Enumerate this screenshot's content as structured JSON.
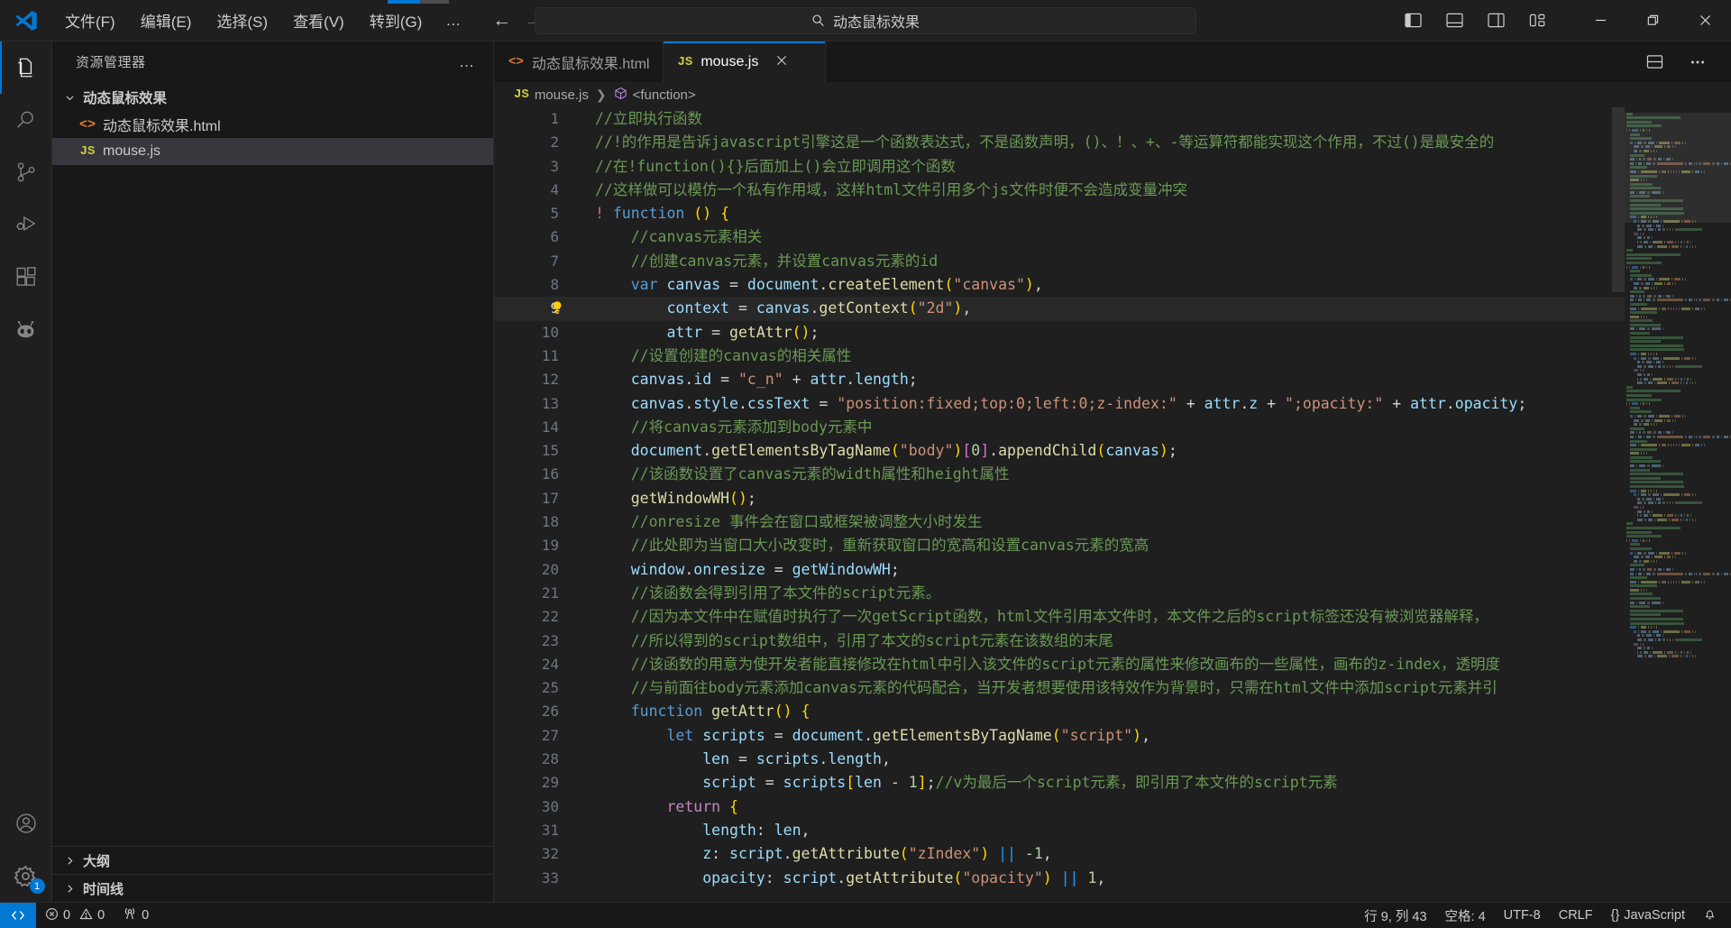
{
  "titlebar": {
    "logo_name": "vscode-logo",
    "menus": [
      "文件(F)",
      "编辑(E)",
      "选择(S)",
      "查看(V)",
      "转到(G)"
    ],
    "more_label": "…",
    "back_label": "←",
    "forward_label": "→",
    "command_center_text": "动态鼠标效果",
    "search_icon": "search-icon",
    "layout_buttons": [
      "toggle-primary-sidebar",
      "toggle-panel",
      "toggle-secondary-sidebar",
      "customize-layout"
    ],
    "window_controls": {
      "minimize": "—",
      "restore": "❐",
      "close": "✕"
    },
    "progress_percent": 52
  },
  "activitybar": {
    "items": [
      {
        "name": "explorer",
        "icon": "files-icon",
        "active": true
      },
      {
        "name": "search",
        "icon": "search-icon",
        "active": false
      },
      {
        "name": "source-control",
        "icon": "source-control-icon",
        "active": false
      },
      {
        "name": "run-and-debug",
        "icon": "debug-icon",
        "active": false
      },
      {
        "name": "extensions",
        "icon": "extensions-icon",
        "active": false
      },
      {
        "name": "copilot",
        "icon": "robot-icon",
        "active": false
      }
    ],
    "bottom": [
      {
        "name": "accounts",
        "icon": "account-icon",
        "badge": ""
      },
      {
        "name": "manage",
        "icon": "gear-icon",
        "badge": "1"
      }
    ]
  },
  "sidebar": {
    "title": "资源管理器",
    "more_actions": "…",
    "tree": [
      {
        "label": "动态鼠标效果",
        "type": "folder",
        "expanded": true,
        "selected": false
      },
      {
        "label": "动态鼠标效果.html",
        "type": "html",
        "selected": false
      },
      {
        "label": "mouse.js",
        "type": "js",
        "selected": true
      }
    ],
    "sections": [
      {
        "label": "大纲",
        "expanded": false
      },
      {
        "label": "时间线",
        "expanded": false
      }
    ]
  },
  "editor": {
    "tabs": [
      {
        "label": "动态鼠标效果.html",
        "type": "html",
        "active": false,
        "closable": false
      },
      {
        "label": "mouse.js",
        "type": "js",
        "active": true,
        "closable": true
      }
    ],
    "tab_actions": [
      "split-editor",
      "more-actions"
    ],
    "breadcrumb": [
      {
        "label": "mouse.js",
        "icon": "js-icon"
      },
      {
        "label": "<function>",
        "icon": "symbol-module-icon"
      }
    ],
    "current_line": 9,
    "first_line": 1,
    "lines": [
      {
        "n": 1,
        "tokens": [
          {
            "t": "//立即执行函数",
            "k": "c"
          }
        ]
      },
      {
        "n": 2,
        "tokens": [
          {
            "t": "//!的作用是告诉javascript引擎这是一个函数表达式，不是函数声明，()、！、+、-等运算符都能实现这个作用，不过()是最安全的",
            "k": "c"
          }
        ]
      },
      {
        "n": 3,
        "tokens": [
          {
            "t": "//在!function(){}后面加上()会立即调用这个函数",
            "k": "c"
          }
        ]
      },
      {
        "n": 4,
        "tokens": [
          {
            "t": "//这样做可以模仿一个私有作用域，这样html文件引用多个js文件时便不会造成变量冲突",
            "k": "c"
          }
        ]
      },
      {
        "n": 5,
        "tokens": [
          {
            "t": "!",
            "k": "bang"
          },
          {
            "t": " ",
            "k": "op"
          },
          {
            "t": "function",
            "k": "kw"
          },
          {
            "t": " ",
            "k": "op"
          },
          {
            "t": "()",
            "k": "p1"
          },
          {
            "t": " ",
            "k": "op"
          },
          {
            "t": "{",
            "k": "p1"
          }
        ]
      },
      {
        "n": 6,
        "indent": 1,
        "tokens": [
          {
            "t": "//canvas元素相关",
            "k": "c"
          }
        ]
      },
      {
        "n": 7,
        "indent": 1,
        "tokens": [
          {
            "t": "//创建canvas元素，并设置canvas元素的id",
            "k": "c"
          }
        ]
      },
      {
        "n": 8,
        "indent": 1,
        "tokens": [
          {
            "t": "var",
            "k": "kw"
          },
          {
            "t": " ",
            "k": "op"
          },
          {
            "t": "canvas",
            "k": "vn"
          },
          {
            "t": " = ",
            "k": "op"
          },
          {
            "t": "document",
            "k": "vn"
          },
          {
            "t": ".",
            "k": "op"
          },
          {
            "t": "createElement",
            "k": "fn"
          },
          {
            "t": "(",
            "k": "p1"
          },
          {
            "t": "\"canvas\"",
            "k": "st"
          },
          {
            "t": ")",
            "k": "p1"
          },
          {
            "t": ",",
            "k": "op"
          }
        ]
      },
      {
        "n": 9,
        "indent": 2,
        "bulb": true,
        "tokens": [
          {
            "t": "context",
            "k": "vn"
          },
          {
            "t": " = ",
            "k": "op"
          },
          {
            "t": "canvas",
            "k": "vn"
          },
          {
            "t": ".",
            "k": "op"
          },
          {
            "t": "getContext",
            "k": "fn"
          },
          {
            "t": "(",
            "k": "p1"
          },
          {
            "t": "\"2d\"",
            "k": "st"
          },
          {
            "t": ")",
            "k": "p1"
          },
          {
            "t": ",",
            "k": "op"
          }
        ]
      },
      {
        "n": 10,
        "indent": 2,
        "tokens": [
          {
            "t": "attr",
            "k": "vn"
          },
          {
            "t": " = ",
            "k": "op"
          },
          {
            "t": "getAttr",
            "k": "fn"
          },
          {
            "t": "(",
            "k": "p1"
          },
          {
            "t": ")",
            "k": "p1"
          },
          {
            "t": ";",
            "k": "op"
          }
        ]
      },
      {
        "n": 11,
        "indent": 1,
        "tokens": [
          {
            "t": "//设置创建的canvas的相关属性",
            "k": "c"
          }
        ]
      },
      {
        "n": 12,
        "indent": 1,
        "tokens": [
          {
            "t": "canvas",
            "k": "vn"
          },
          {
            "t": ".",
            "k": "op"
          },
          {
            "t": "id",
            "k": "vn"
          },
          {
            "t": " = ",
            "k": "op"
          },
          {
            "t": "\"c_n\"",
            "k": "st"
          },
          {
            "t": " + ",
            "k": "op"
          },
          {
            "t": "attr",
            "k": "vn"
          },
          {
            "t": ".",
            "k": "op"
          },
          {
            "t": "length",
            "k": "vn"
          },
          {
            "t": ";",
            "k": "op"
          }
        ]
      },
      {
        "n": 13,
        "indent": 1,
        "tokens": [
          {
            "t": "canvas",
            "k": "vn"
          },
          {
            "t": ".",
            "k": "op"
          },
          {
            "t": "style",
            "k": "vn"
          },
          {
            "t": ".",
            "k": "op"
          },
          {
            "t": "cssText",
            "k": "vn"
          },
          {
            "t": " = ",
            "k": "op"
          },
          {
            "t": "\"position:fixed;top:0;left:0;z-index:\"",
            "k": "st"
          },
          {
            "t": " + ",
            "k": "op"
          },
          {
            "t": "attr",
            "k": "vn"
          },
          {
            "t": ".",
            "k": "op"
          },
          {
            "t": "z",
            "k": "vn"
          },
          {
            "t": " + ",
            "k": "op"
          },
          {
            "t": "\";opacity:\"",
            "k": "st"
          },
          {
            "t": " + ",
            "k": "op"
          },
          {
            "t": "attr",
            "k": "vn"
          },
          {
            "t": ".",
            "k": "op"
          },
          {
            "t": "opacity",
            "k": "vn"
          },
          {
            "t": ";",
            "k": "op"
          }
        ]
      },
      {
        "n": 14,
        "indent": 1,
        "tokens": [
          {
            "t": "//将canvas元素添加到body元素中",
            "k": "c"
          }
        ]
      },
      {
        "n": 15,
        "indent": 1,
        "tokens": [
          {
            "t": "document",
            "k": "vn"
          },
          {
            "t": ".",
            "k": "op"
          },
          {
            "t": "getElementsByTagName",
            "k": "fn"
          },
          {
            "t": "(",
            "k": "p1"
          },
          {
            "t": "\"body\"",
            "k": "st"
          },
          {
            "t": ")",
            "k": "p1"
          },
          {
            "t": "[",
            "k": "p2"
          },
          {
            "t": "0",
            "k": "nm"
          },
          {
            "t": "]",
            "k": "p2"
          },
          {
            "t": ".",
            "k": "op"
          },
          {
            "t": "appendChild",
            "k": "fn"
          },
          {
            "t": "(",
            "k": "p1"
          },
          {
            "t": "canvas",
            "k": "vn"
          },
          {
            "t": ")",
            "k": "p1"
          },
          {
            "t": ";",
            "k": "op"
          }
        ]
      },
      {
        "n": 16,
        "indent": 1,
        "tokens": [
          {
            "t": "//该函数设置了canvas元素的width属性和height属性",
            "k": "c"
          }
        ]
      },
      {
        "n": 17,
        "indent": 1,
        "tokens": [
          {
            "t": "getWindowWH",
            "k": "fn"
          },
          {
            "t": "(",
            "k": "p1"
          },
          {
            "t": ")",
            "k": "p1"
          },
          {
            "t": ";",
            "k": "op"
          }
        ]
      },
      {
        "n": 18,
        "indent": 1,
        "tokens": [
          {
            "t": "//onresize 事件会在窗口或框架被调整大小时发生",
            "k": "c"
          }
        ]
      },
      {
        "n": 19,
        "indent": 1,
        "tokens": [
          {
            "t": "//此处即为当窗口大小改变时，重新获取窗口的宽高和设置canvas元素的宽高",
            "k": "c"
          }
        ]
      },
      {
        "n": 20,
        "indent": 1,
        "tokens": [
          {
            "t": "window",
            "k": "vn"
          },
          {
            "t": ".",
            "k": "op"
          },
          {
            "t": "onresize",
            "k": "vn"
          },
          {
            "t": " = ",
            "k": "op"
          },
          {
            "t": "getWindowWH",
            "k": "vn"
          },
          {
            "t": ";",
            "k": "op"
          }
        ]
      },
      {
        "n": 21,
        "indent": 1,
        "tokens": [
          {
            "t": "//该函数会得到引用了本文件的script元素。",
            "k": "c"
          }
        ]
      },
      {
        "n": 22,
        "indent": 1,
        "tokens": [
          {
            "t": "//因为本文件中在赋值时执行了一次getScript函数，html文件引用本文件时，本文件之后的script标签还没有被浏览器解释，",
            "k": "c"
          }
        ]
      },
      {
        "n": 23,
        "indent": 1,
        "tokens": [
          {
            "t": "//所以得到的script数组中，引用了本文的script元素在该数组的末尾",
            "k": "c"
          }
        ]
      },
      {
        "n": 24,
        "indent": 1,
        "tokens": [
          {
            "t": "//该函数的用意为使开发者能直接修改在html中引入该文件的script元素的属性来修改画布的一些属性，画布的z-index，透明度",
            "k": "c"
          }
        ]
      },
      {
        "n": 25,
        "indent": 1,
        "tokens": [
          {
            "t": "//与前面往body元素添加canvas元素的代码配合，当开发者想要使用该特效作为背景时，只需在html文件中添加script元素并引",
            "k": "c"
          }
        ]
      },
      {
        "n": 26,
        "indent": 1,
        "tokens": [
          {
            "t": "function",
            "k": "kw"
          },
          {
            "t": " ",
            "k": "op"
          },
          {
            "t": "getAttr",
            "k": "fn"
          },
          {
            "t": "(",
            "k": "p1"
          },
          {
            "t": ")",
            "k": "p1"
          },
          {
            "t": " ",
            "k": "op"
          },
          {
            "t": "{",
            "k": "p1"
          }
        ]
      },
      {
        "n": 27,
        "indent": 2,
        "tokens": [
          {
            "t": "let",
            "k": "kw"
          },
          {
            "t": " ",
            "k": "op"
          },
          {
            "t": "scripts",
            "k": "vn"
          },
          {
            "t": " = ",
            "k": "op"
          },
          {
            "t": "document",
            "k": "vn"
          },
          {
            "t": ".",
            "k": "op"
          },
          {
            "t": "getElementsByTagName",
            "k": "fn"
          },
          {
            "t": "(",
            "k": "p1"
          },
          {
            "t": "\"script\"",
            "k": "st"
          },
          {
            "t": ")",
            "k": "p1"
          },
          {
            "t": ",",
            "k": "op"
          }
        ]
      },
      {
        "n": 28,
        "indent": 3,
        "tokens": [
          {
            "t": "len",
            "k": "vn"
          },
          {
            "t": " = ",
            "k": "op"
          },
          {
            "t": "scripts",
            "k": "vn"
          },
          {
            "t": ".",
            "k": "op"
          },
          {
            "t": "length",
            "k": "vn"
          },
          {
            "t": ",",
            "k": "op"
          }
        ]
      },
      {
        "n": 29,
        "indent": 3,
        "tokens": [
          {
            "t": "script",
            "k": "vn"
          },
          {
            "t": " = ",
            "k": "op"
          },
          {
            "t": "scripts",
            "k": "vn"
          },
          {
            "t": "[",
            "k": "p1"
          },
          {
            "t": "len",
            "k": "vn"
          },
          {
            "t": " - ",
            "k": "op"
          },
          {
            "t": "1",
            "k": "nm"
          },
          {
            "t": "]",
            "k": "p1"
          },
          {
            "t": ";",
            "k": "op"
          },
          {
            "t": "//v为最后一个script元素，即引用了本文件的script元素",
            "k": "c"
          }
        ]
      },
      {
        "n": 30,
        "indent": 2,
        "tokens": [
          {
            "t": "return",
            "k": "kwp"
          },
          {
            "t": " ",
            "k": "op"
          },
          {
            "t": "{",
            "k": "p1"
          }
        ]
      },
      {
        "n": 31,
        "indent": 3,
        "tokens": [
          {
            "t": "length",
            "k": "vn"
          },
          {
            "t": ": ",
            "k": "op"
          },
          {
            "t": "len",
            "k": "vn"
          },
          {
            "t": ",",
            "k": "op"
          }
        ]
      },
      {
        "n": 32,
        "indent": 3,
        "tokens": [
          {
            "t": "z",
            "k": "vn"
          },
          {
            "t": ": ",
            "k": "op"
          },
          {
            "t": "script",
            "k": "vn"
          },
          {
            "t": ".",
            "k": "op"
          },
          {
            "t": "getAttribute",
            "k": "fn"
          },
          {
            "t": "(",
            "k": "p1"
          },
          {
            "t": "\"zIndex\"",
            "k": "st"
          },
          {
            "t": ")",
            "k": "p1"
          },
          {
            "t": " ",
            "k": "op"
          },
          {
            "t": "||",
            "k": "p3"
          },
          {
            "t": " ",
            "k": "op"
          },
          {
            "t": "-1",
            "k": "nm"
          },
          {
            "t": ",",
            "k": "op"
          }
        ]
      },
      {
        "n": 33,
        "indent": 3,
        "tokens": [
          {
            "t": "opacity",
            "k": "vn"
          },
          {
            "t": ": ",
            "k": "op"
          },
          {
            "t": "script",
            "k": "vn"
          },
          {
            "t": ".",
            "k": "op"
          },
          {
            "t": "getAttribute",
            "k": "fn"
          },
          {
            "t": "(",
            "k": "p1"
          },
          {
            "t": "\"opacity\"",
            "k": "st"
          },
          {
            "t": ")",
            "k": "p1"
          },
          {
            "t": " ",
            "k": "op"
          },
          {
            "t": "||",
            "k": "p3"
          },
          {
            "t": " ",
            "k": "op"
          },
          {
            "t": "1",
            "k": "nm"
          },
          {
            "t": ",",
            "k": "op"
          }
        ]
      }
    ]
  },
  "statusbar": {
    "remote_icon": "remote-icon",
    "left": [
      {
        "name": "problems",
        "icon": "error-icon",
        "errors": "0",
        "warnings": "0"
      },
      {
        "name": "ports",
        "icon": "radio-tower-icon",
        "value": "0"
      }
    ],
    "right": [
      {
        "name": "cursor-position",
        "label": "行 9, 列 43"
      },
      {
        "name": "indentation",
        "label": "空格: 4"
      },
      {
        "name": "encoding",
        "label": "UTF-8"
      },
      {
        "name": "eol",
        "label": "CRLF"
      },
      {
        "name": "language-mode",
        "label": "JavaScript",
        "prefix": "{}"
      },
      {
        "name": "notifications",
        "label": ""
      }
    ]
  },
  "colors": {
    "accent": "#0078d4",
    "titlebar_bg": "#1f1f1f",
    "sidebar_bg": "#181818",
    "editor_bg": "#1f1f1f",
    "comment": "#6a9955",
    "string": "#ce9178",
    "keyword": "#569cd6",
    "function": "#dcdcaa",
    "variable": "#9cdcfe"
  }
}
